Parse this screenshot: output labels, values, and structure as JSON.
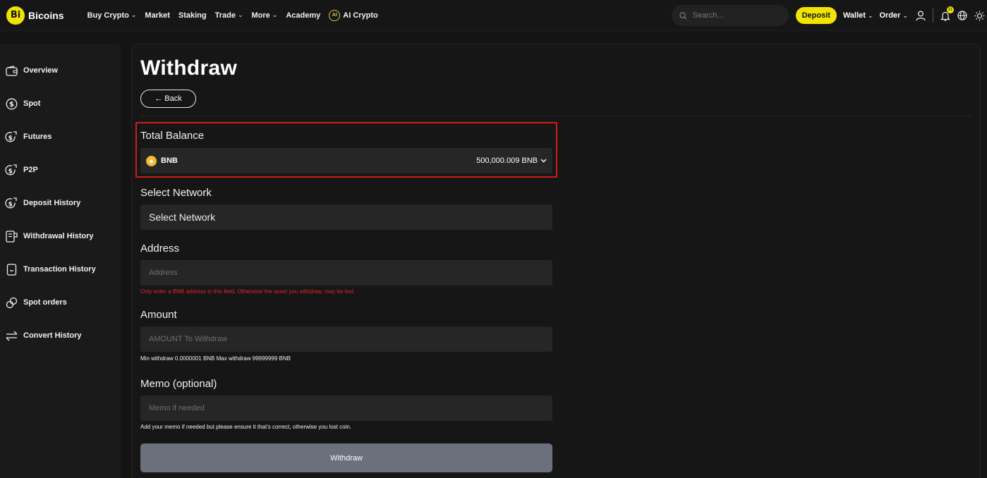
{
  "brand": {
    "mark": "Bi",
    "name": "Bicoins"
  },
  "nav": [
    {
      "label": "Buy Crypto",
      "dropdown": true
    },
    {
      "label": "Market",
      "dropdown": false
    },
    {
      "label": "Staking",
      "dropdown": false
    },
    {
      "label": "Trade",
      "dropdown": true
    },
    {
      "label": "More",
      "dropdown": true
    },
    {
      "label": "Academy",
      "dropdown": false
    },
    {
      "label": "AI Crypto",
      "dropdown": false,
      "icon": "ai-icon"
    }
  ],
  "header": {
    "search_placeholder": "Search...",
    "deposit_label": "Deposit",
    "wallet_label": "Wallet",
    "order_label": "Order",
    "notification_count": "31",
    "accent_color": "#f0e400"
  },
  "sidebar": {
    "items": [
      {
        "label": "Overview",
        "icon": "wallet-icon"
      },
      {
        "label": "Spot",
        "icon": "dollar-circle-icon"
      },
      {
        "label": "Futures",
        "icon": "coin-arrow-icon"
      },
      {
        "label": "P2P",
        "icon": "coin-arrow-icon"
      },
      {
        "label": "Deposit History",
        "icon": "coin-arrow-icon"
      },
      {
        "label": "Withdrawal History",
        "icon": "receipt-icon"
      },
      {
        "label": "Transaction History",
        "icon": "document-icon"
      },
      {
        "label": "Spot orders",
        "icon": "link-icon"
      },
      {
        "label": "Convert History",
        "icon": "swap-icon"
      }
    ]
  },
  "main": {
    "title": "Withdraw",
    "back_label": "← Back",
    "total_balance": {
      "label": "Total Balance",
      "coin": "BNB",
      "amount": "500,000.009 BNB",
      "highlight_color": "#d51a1a"
    },
    "network": {
      "label": "Select Network",
      "value": "Select Network"
    },
    "address": {
      "label": "Address",
      "placeholder": "Address",
      "warning": "Only enter a BNB address in this field. Otherwise the asset you withdraw, may be lost."
    },
    "amount": {
      "label": "Amount",
      "placeholder": "AMOUNT To Withdraw",
      "hint": "Min withdraw 0.0000001 BNB  Max withdraw 99999999 BNB"
    },
    "memo": {
      "label": "Memo (optional)",
      "placeholder": "Memo if needed",
      "hint": "Add your memo if needed but please ensure it that's correct, otherwise you lost coin."
    },
    "submit_label": "Withdraw"
  }
}
